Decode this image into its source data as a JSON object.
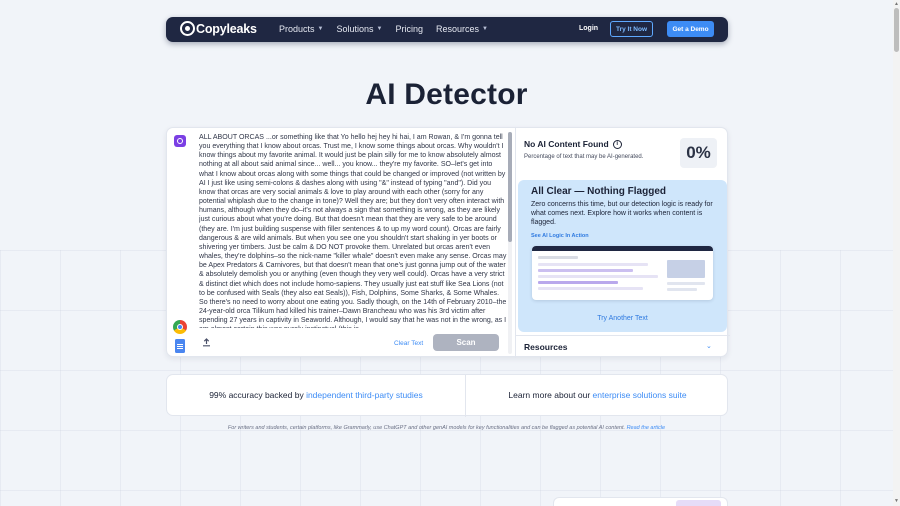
{
  "nav": {
    "logo": "Copyleaks",
    "links": [
      "Products",
      "Solutions",
      "Pricing",
      "Resources"
    ],
    "login": "Login",
    "try_now": "Try It Now",
    "demo": "Get a Demo"
  },
  "page_title": "AI Detector",
  "editor": {
    "text": "ALL ABOUT ORCAS ...or something like that Yo hello hej hey hi hai, I am Rowan, & I'm gonna tell you everything that I know about orcas. Trust me, I know some things about orcas. Why wouldn't I know things about my favorite animal. It would just be plain silly for me to know absolutely almost nothing at all about said animal since... well... you know... they're my favorite. SO–let's get into what I know about orcas along with some things that could be changed or improved (not written by AI I just like using semi-colons & dashes along with using \"&\" instead of typing \"and\"). Did you know that orcas are very social animals & love to play around with each other (sorry for any potential whiplash due to the change in tone)? Well they are; but they don't very often interact with humans, although when they do–it's not always a sign that something is wrong, as they are likely just curious about what you're doing. But that doesn't mean that they are very safe to be around (they are. I'm just building suspense with filler sentences & to up my word count). Orcas are fairly dangerous & are wild animals. But when you see one you shouldn't start shaking in yer boots or shivering yer timbers. Just be calm & DO NOT provoke them. Unrelated but orcas aren't even whales, they're dolphins–so the nick-name \"killer whale\" doesn't even make any sense. Orcas may be Apex Predators & Carnivores, but that doesn't mean that one's just gonna jump out of the water & absolutely demolish you or anything (even though they very well could). Orcas have a very strict & distinct diet which does not include homo-sapiens. They usually just eat stuff like Sea Lions (not to be confused with Seals (they also eat Seals)), Fish, Dolphins, Some Sharks, & Some Whales. So there's no need to worry about one eating you. Sadly though, on the 14th of February 2010–the 24-year-old orca Tilikum had killed his trainer–Dawn Brancheau who was his 3rd victim after spending 27 years in captivity in Seaworld. Although, I would say that he was not in the wrong, as I am almost certain this was purely instinctual (this is",
    "clear_label": "Clear Text",
    "scan_label": "Scan"
  },
  "result": {
    "title": "No AI Content Found",
    "subtitle": "Percentage of text that may be AI-generated.",
    "percent": "0%"
  },
  "clear_panel": {
    "title": "All Clear — Nothing Flagged",
    "desc": "Zero concerns this time, but our detection logic is ready for what comes next. Explore how it works when content is flagged.",
    "link": "See AI Logic In Action",
    "try_again": "Try Another Text"
  },
  "resources_label": "Resources",
  "strip": {
    "left_prefix": "99% accuracy backed by ",
    "left_link": "independent third-party studies",
    "right_prefix": "Learn more about our ",
    "right_link": "enterprise solutions suite"
  },
  "footnote": {
    "text": "For writers and students, certain platforms, like Grammarly, use ChatGPT and other genAI models for key functionalities and can be flagged as potential AI content. ",
    "link": "Read the article"
  },
  "colors": {
    "nav_bg": "#1f2742",
    "accent": "#3d8cf5",
    "panel_bg": "#cfe6fb",
    "scan_disabled": "#aeb3c0"
  }
}
